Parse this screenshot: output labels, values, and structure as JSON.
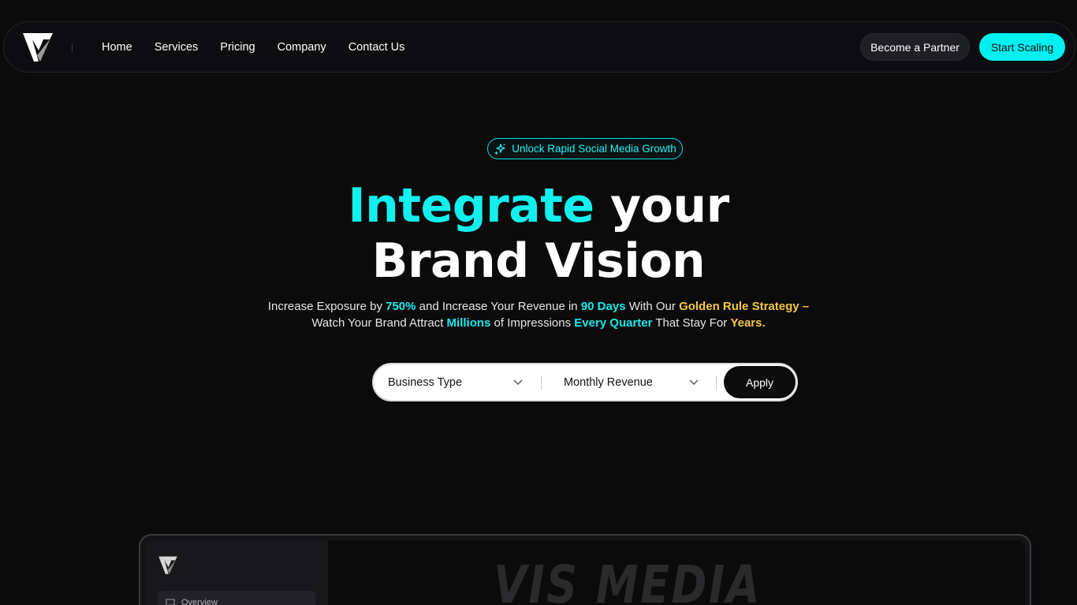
{
  "nav": {
    "links": [
      "Home",
      "Services",
      "Pricing",
      "Company",
      "Contact Us"
    ],
    "partner_label": "Become a Partner",
    "start_label": "Start Scaling"
  },
  "hero": {
    "badge": "Unlock Rapid Social Media Growth",
    "title_highlight": "Integrate",
    "title_rest": " your",
    "title_line2": "Brand Vision",
    "sub": {
      "p1": "Increase Exposure by ",
      "h1": "750%",
      "p2": " and Increase Your Revenue in ",
      "h2": "90 Days",
      "p3": " With Our ",
      "h3": "Golden Rule Strategy –",
      "p4": "Watch Your Brand Attract ",
      "h4": "Millions",
      "p5": " of Impressions ",
      "h5": "Every Quarter",
      "p6": " That Stay For ",
      "h6": "Years."
    }
  },
  "filter": {
    "business_type": "Business Type",
    "monthly_revenue": "Monthly Revenue",
    "apply_label": "Apply"
  },
  "preview": {
    "sidebar_item": "Overview",
    "brand_text": "VIS MEDIA"
  },
  "colors": {
    "accent": "#00f0f0",
    "highlight_yellow": "#f5c842",
    "background": "#0b0b0c"
  }
}
